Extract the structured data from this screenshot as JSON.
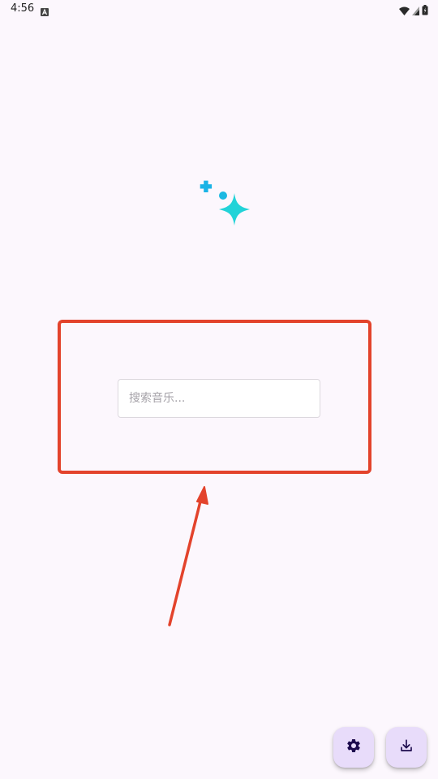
{
  "status_bar": {
    "time": "4:56",
    "icons": [
      "notification-a-icon",
      "wifi-icon",
      "cell-signal-icon",
      "battery-icon"
    ]
  },
  "logo": {
    "icon": "sparkle-icon",
    "colors": [
      "#19b3e6",
      "#22d3d8"
    ]
  },
  "search": {
    "placeholder": "搜索音乐...",
    "value": ""
  },
  "fabs": {
    "settings_icon": "gear-icon",
    "download_icon": "download-icon",
    "background": "#e8dcfa",
    "icon_color": "#1d0b4e"
  },
  "annotation": {
    "color": "#e3432c"
  }
}
